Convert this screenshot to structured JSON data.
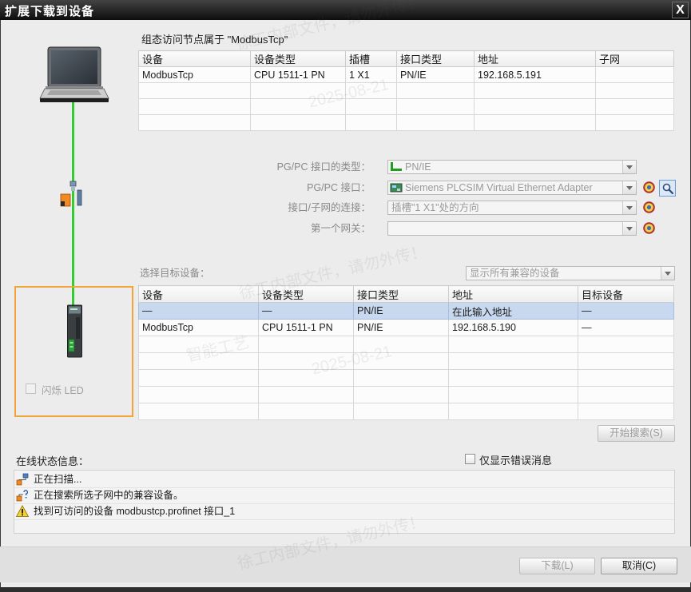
{
  "window": {
    "title": "扩展下载到设备",
    "close_label": "X"
  },
  "topology": {
    "flash_led": {
      "label": "闪烁 LED",
      "checked": false,
      "enabled": false
    }
  },
  "config_table": {
    "caption": "组态访问节点属于 \"ModbusTcp\"",
    "columns": [
      "设备",
      "设备类型",
      "插槽",
      "接口类型",
      "地址",
      "子网"
    ],
    "rows": [
      {
        "device": "ModbusTcp",
        "device_type": "CPU 1511-1 PN",
        "slot": "1 X1",
        "interface_type": "PN/IE",
        "address": "192.168.5.191",
        "subnet": ""
      }
    ]
  },
  "interface": {
    "pgpc_type": {
      "label": "PG/PC 接口的类型：",
      "value": "PN/IE",
      "icon": "pnie-network-icon"
    },
    "pgpc_interface": {
      "label": "PG/PC 接口：",
      "value": "Siemens PLCSIM Virtual Ethernet Adapter",
      "icon": "network-adapter-icon"
    },
    "subnet_connection": {
      "label": "接口/子网的连接：",
      "value": "插槽\"1 X1\"处的方向"
    },
    "first_gateway": {
      "label": "第一个网关：",
      "value": ""
    }
  },
  "target_selection": {
    "label": "选择目标设备：",
    "filter_value": "显示所有兼容的设备",
    "columns": [
      "设备",
      "设备类型",
      "接口类型",
      "地址",
      "目标设备"
    ],
    "rows": [
      {
        "device": "—",
        "device_type": "—",
        "interface_type": "PN/IE",
        "address": "在此输入地址",
        "target_device": "—",
        "selected": true
      },
      {
        "device": "ModbusTcp",
        "device_type": "CPU 1511-1 PN",
        "interface_type": "PN/IE",
        "address": "192.168.5.190",
        "target_device": "—",
        "selected": false
      }
    ],
    "search_button": {
      "label": "开始搜索(S)",
      "enabled": false
    }
  },
  "status": {
    "label": "在线状态信息：",
    "errors_only": {
      "label": "仅显示错误消息",
      "checked": false
    },
    "messages": [
      {
        "icon": "scan-network-icon",
        "text": "正在扫描..."
      },
      {
        "icon": "search-subnet-icon",
        "text": "正在搜索所选子网中的兼容设备。"
      },
      {
        "icon": "warning-icon",
        "text": "找到可访问的设备 modbustcp.profinet 接口_1"
      }
    ]
  },
  "footer": {
    "download": {
      "label": "下载(L)",
      "enabled": false
    },
    "cancel": {
      "label": "取消(C)",
      "enabled": true
    }
  },
  "watermarks": [
    "徐工内部文件，请勿外传！",
    "2025-08-21",
    "智能工艺"
  ],
  "colors": {
    "title_bar": "#141414",
    "connection_line": "#33cc33",
    "device_frame": "#f2a33a",
    "selected_row": "#c8d9ef"
  }
}
